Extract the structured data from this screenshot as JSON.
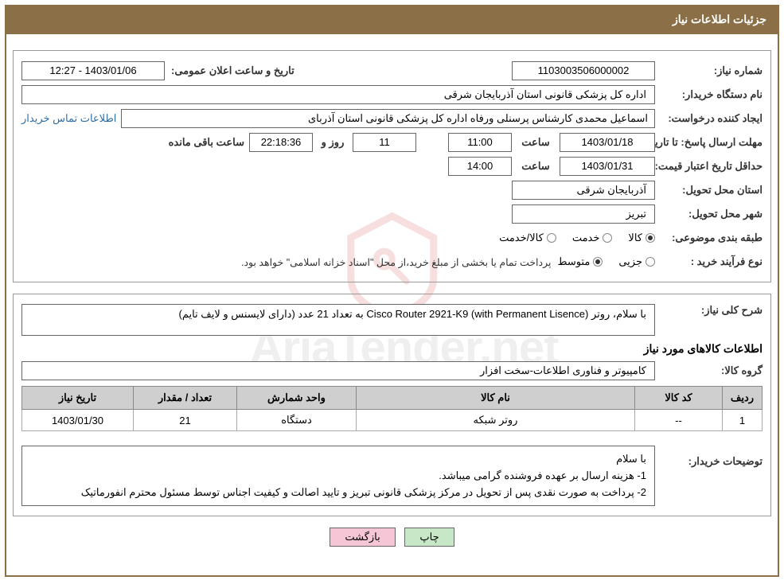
{
  "header": {
    "title": "جزئیات اطلاعات نیاز"
  },
  "fields": {
    "need_no_label": "شماره نیاز:",
    "need_no": "1103003506000002",
    "announce_label": "تاریخ و ساعت اعلان عمومی:",
    "announce_val": "1403/01/06 - 12:27",
    "buyer_label": "نام دستگاه خریدار:",
    "buyer_val": "اداره کل پزشکی قانونی استان آذربایجان شرقی",
    "requester_label": "ایجاد کننده درخواست:",
    "requester_val": "اسماعیل محمدی کارشناس پرسنلی ورفاه اداره کل پزشکی قانونی استان آذربای",
    "buyer_contact_link": "اطلاعات تماس خریدار",
    "resp_deadline_label": "مهلت ارسال پاسخ:",
    "until_date_label": "تا تاریخ:",
    "resp_date": "1403/01/18",
    "hour_label": "ساعت",
    "resp_hour": "11:00",
    "days_val": "11",
    "days_and_label": "روز و",
    "countdown": "22:18:36",
    "countdown_label": "ساعت باقی مانده",
    "valid_label": "حداقل تاریخ اعتبار قیمت:",
    "valid_date": "1403/01/31",
    "valid_hour": "14:00",
    "province_label": "استان محل تحویل:",
    "province_val": "آذربایجان شرقی",
    "city_label": "شهر محل تحویل:",
    "city_val": "تبریز",
    "class_label": "طبقه بندی موضوعی:",
    "class_good": "کالا",
    "class_service": "خدمت",
    "class_goodservice": "کالا/خدمت",
    "proc_type_label": "نوع فرآیند خرید :",
    "proc_partial": "جزیی",
    "proc_mid": "متوسط",
    "proc_note": "پرداخت تمام یا بخشی از مبلغ خرید،از محل \"اسناد خزانه اسلامی\" خواهد بود."
  },
  "desc": {
    "label": "شرح کلی نیاز:",
    "text": "با سلام، روتر Cisco Router 2921-K9 (with Permanent Lisence)  به تعداد 21 عدد (دارای لایسنس و لایف تایم)"
  },
  "goods": {
    "title": "اطلاعات کالاهای مورد نیاز",
    "group_label": "گروه کالا:",
    "group_val": "کامپیوتر و فناوری اطلاعات-سخت افزار",
    "cols": {
      "row": "ردیف",
      "code": "کد کالا",
      "name": "نام کالا",
      "unit": "واحد شمارش",
      "qty": "تعداد / مقدار",
      "date": "تاریخ نیاز"
    },
    "rows": [
      {
        "idx": "1",
        "code": "--",
        "name": "روتر شبکه",
        "unit": "دستگاه",
        "qty": "21",
        "date": "1403/01/30"
      }
    ]
  },
  "buyer_notes": {
    "label": "توضیحات خریدار:",
    "l1": "با سلام",
    "l2": "1- هزینه ارسال بر عهده فروشنده گرامی میباشد.",
    "l3": "2- پرداخت به صورت نقدی پس از تحویل در مرکز پزشکی قانونی تبریز و تایید اصالت و کیفیت اجناس توسط مسئول محترم انفورماتیک"
  },
  "buttons": {
    "print": "چاپ",
    "back": "بازگشت"
  },
  "watermark": {
    "text": "AriaTender.net"
  }
}
